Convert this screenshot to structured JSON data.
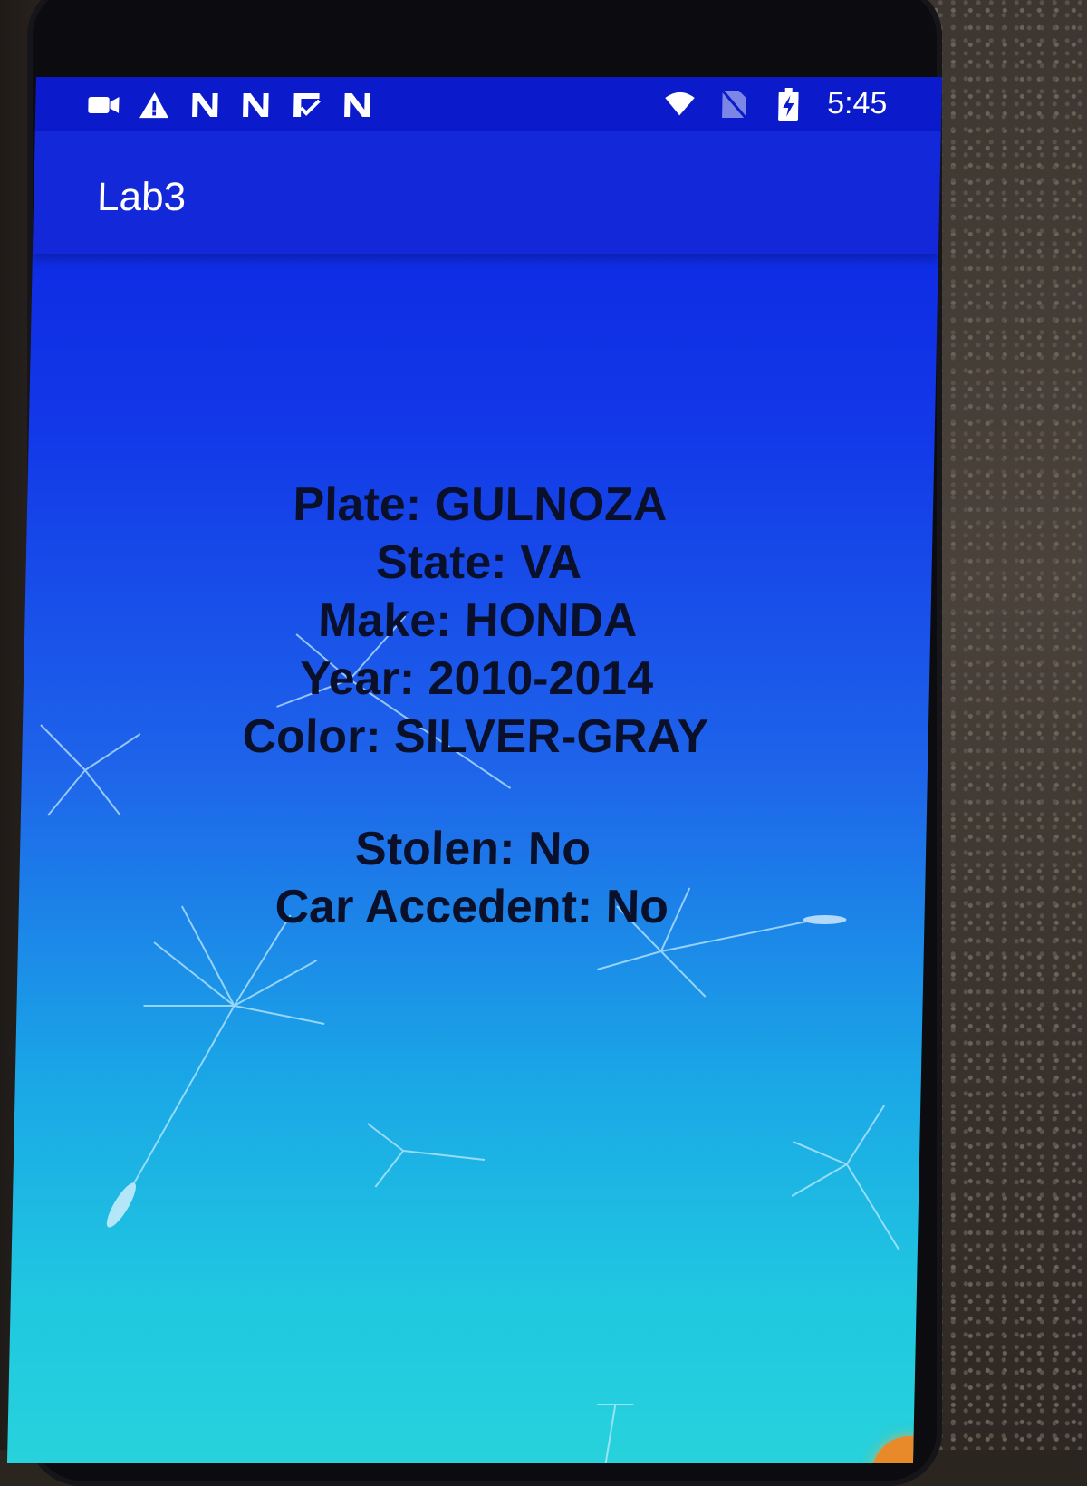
{
  "status_bar": {
    "time": "5:45",
    "left_icons": [
      "video-camera-icon",
      "warning-icon",
      "n-notification-icon",
      "n-notification-icon",
      "n-check-notification-icon",
      "n-notification-icon"
    ],
    "right_icons": [
      "wifi-icon",
      "no-sim-icon",
      "battery-charging-icon"
    ]
  },
  "app_bar": {
    "title": "Lab3"
  },
  "details": {
    "plate": "Plate: GULNOZA",
    "state": "State: VA",
    "make": "Make: HONDA",
    "year": "Year: 2010-2014",
    "color": "Color: SILVER-GRAY",
    "stolen": "Stolen: No",
    "accident": "Car Accedent: No"
  },
  "colors": {
    "status_bar": "#0b1bcc",
    "app_bar": "#1328d8",
    "text": "#0a0f2a"
  }
}
